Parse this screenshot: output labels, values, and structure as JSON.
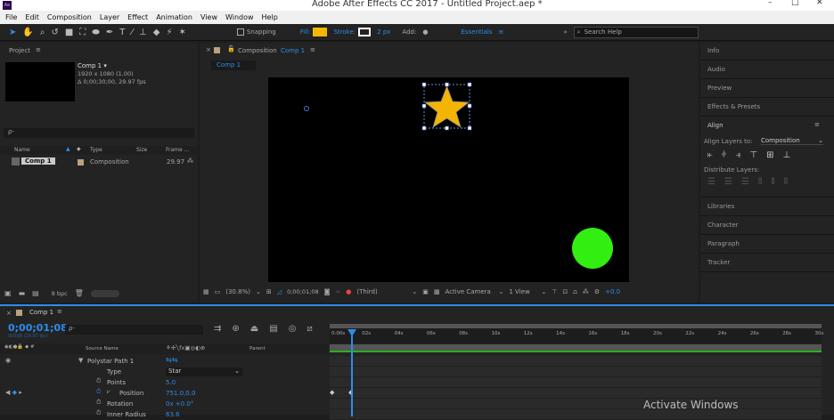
{
  "app": {
    "title": "Adobe After Effects CC 2017 - Untitled Project.aep *",
    "icon_label": "Ae"
  },
  "menu": [
    "File",
    "Edit",
    "Composition",
    "Layer",
    "Effect",
    "Animation",
    "View",
    "Window",
    "Help"
  ],
  "toolbar": {
    "snapping": "Snapping",
    "fill": "Fill:",
    "stroke": "Stroke:",
    "stroke_width": "2 px",
    "add": "Add:",
    "workspace": "Essentials",
    "search": "Search Help",
    "fill_color": "#f5b800"
  },
  "project": {
    "title": "Project",
    "comp_name": "Comp 1 ▾",
    "comp_size": "1920 x 1080 (1.00)",
    "comp_duration": "Δ 0;00;30;00, 29.97 fps",
    "search_placeholder": "ρ-",
    "cols": [
      "Name",
      "Type",
      "Size",
      "Frame ..."
    ],
    "item": {
      "name": "Comp 1",
      "type": "Composition",
      "fps": "29.97"
    },
    "bpc": "8 bpc"
  },
  "comp": {
    "tab_title": "Composition",
    "tab_comp": "Comp 1",
    "sub_tab": "Comp 1",
    "zoom": "(30.8%)",
    "timecode": "0;00;01;08",
    "view_mode": "(Third)",
    "camera": "Active Camera",
    "views": "1 View",
    "exposure": "+0.0",
    "star_color": "#f5b400",
    "circle_color": "#33ee11"
  },
  "right": {
    "items": [
      "Info",
      "Audio",
      "Preview",
      "Effects & Presets"
    ],
    "align": "Align",
    "align_to_label": "Align Layers to:",
    "align_to": "Composition",
    "distribute": "Distribute Layers:",
    "bottom": [
      "Libraries",
      "Character",
      "Paragraph",
      "Tracker"
    ]
  },
  "timeline": {
    "tab": "Comp 1",
    "timecode": "0;00;01;08",
    "frame": "00038 (29.97 fps)",
    "source_name": "Source Name",
    "parent": "Parent",
    "ruler": [
      "0:00s",
      "02s",
      "04s",
      "06s",
      "08s",
      "10s",
      "12s",
      "14s",
      "16s",
      "18s",
      "20s",
      "22s",
      "24s",
      "26s",
      "28s",
      "30s"
    ],
    "rows": [
      {
        "name": "Polystar Path 1",
        "value": ""
      },
      {
        "name": "Type",
        "value": "Star"
      },
      {
        "name": "Points",
        "value": "5.0"
      },
      {
        "name": "Position",
        "value": "751.0,0.0"
      },
      {
        "name": "Rotation",
        "value": "0x +0.0°"
      },
      {
        "name": "Inner Radius",
        "value": "63.6"
      }
    ]
  },
  "watermark": "Activate Windows"
}
